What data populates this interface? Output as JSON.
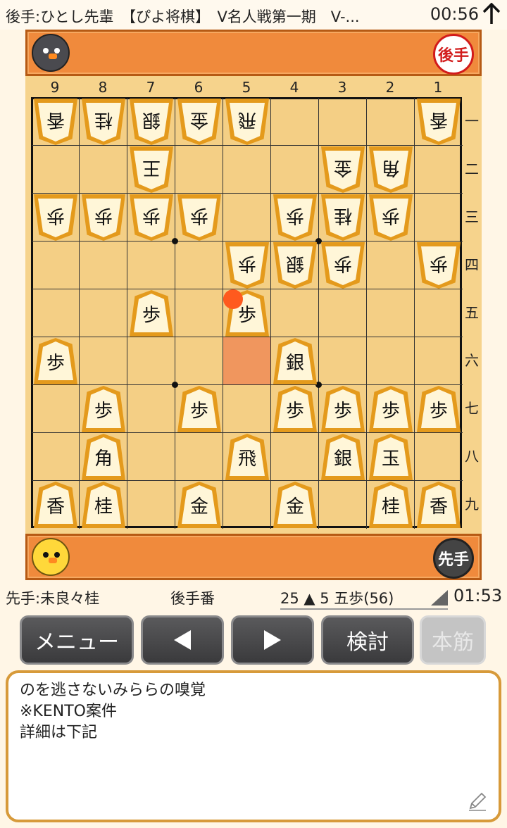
{
  "status": {
    "title": "後手:ひとし先輩　【ぴよ将棋】　V名人戦第一期　V-...",
    "clock": "00:56"
  },
  "top_hand": {
    "badge": "後手"
  },
  "bottom_hand": {
    "badge": "先手"
  },
  "file_labels": [
    "9",
    "8",
    "7",
    "6",
    "5",
    "4",
    "3",
    "2",
    "1"
  ],
  "rank_labels": [
    "一",
    "二",
    "三",
    "四",
    "五",
    "六",
    "七",
    "八",
    "九"
  ],
  "pieces": [
    {
      "file": 9,
      "rank": 1,
      "char": "香",
      "owner": "gote"
    },
    {
      "file": 8,
      "rank": 1,
      "char": "桂",
      "owner": "gote"
    },
    {
      "file": 7,
      "rank": 1,
      "char": "銀",
      "owner": "gote"
    },
    {
      "file": 6,
      "rank": 1,
      "char": "金",
      "owner": "gote"
    },
    {
      "file": 5,
      "rank": 1,
      "char": "飛",
      "owner": "gote"
    },
    {
      "file": 1,
      "rank": 1,
      "char": "香",
      "owner": "gote"
    },
    {
      "file": 7,
      "rank": 2,
      "char": "王",
      "owner": "gote"
    },
    {
      "file": 3,
      "rank": 2,
      "char": "金",
      "owner": "gote"
    },
    {
      "file": 2,
      "rank": 2,
      "char": "角",
      "owner": "gote"
    },
    {
      "file": 9,
      "rank": 3,
      "char": "歩",
      "owner": "gote"
    },
    {
      "file": 8,
      "rank": 3,
      "char": "歩",
      "owner": "gote"
    },
    {
      "file": 7,
      "rank": 3,
      "char": "歩",
      "owner": "gote"
    },
    {
      "file": 6,
      "rank": 3,
      "char": "歩",
      "owner": "gote"
    },
    {
      "file": 4,
      "rank": 3,
      "char": "歩",
      "owner": "gote"
    },
    {
      "file": 3,
      "rank": 3,
      "char": "桂",
      "owner": "gote"
    },
    {
      "file": 2,
      "rank": 3,
      "char": "歩",
      "owner": "gote"
    },
    {
      "file": 5,
      "rank": 4,
      "char": "歩",
      "owner": "gote"
    },
    {
      "file": 4,
      "rank": 4,
      "char": "銀",
      "owner": "gote"
    },
    {
      "file": 3,
      "rank": 4,
      "char": "歩",
      "owner": "gote"
    },
    {
      "file": 1,
      "rank": 4,
      "char": "歩",
      "owner": "gote"
    },
    {
      "file": 7,
      "rank": 5,
      "char": "歩",
      "owner": "sente"
    },
    {
      "file": 5,
      "rank": 5,
      "char": "歩",
      "owner": "sente"
    },
    {
      "file": 9,
      "rank": 6,
      "char": "歩",
      "owner": "sente"
    },
    {
      "file": 4,
      "rank": 6,
      "char": "銀",
      "owner": "sente"
    },
    {
      "file": 8,
      "rank": 7,
      "char": "歩",
      "owner": "sente"
    },
    {
      "file": 6,
      "rank": 7,
      "char": "歩",
      "owner": "sente"
    },
    {
      "file": 4,
      "rank": 7,
      "char": "歩",
      "owner": "sente"
    },
    {
      "file": 3,
      "rank": 7,
      "char": "歩",
      "owner": "sente"
    },
    {
      "file": 2,
      "rank": 7,
      "char": "歩",
      "owner": "sente"
    },
    {
      "file": 1,
      "rank": 7,
      "char": "歩",
      "owner": "sente"
    },
    {
      "file": 8,
      "rank": 8,
      "char": "角",
      "owner": "sente"
    },
    {
      "file": 5,
      "rank": 8,
      "char": "飛",
      "owner": "sente"
    },
    {
      "file": 3,
      "rank": 8,
      "char": "銀",
      "owner": "sente"
    },
    {
      "file": 2,
      "rank": 8,
      "char": "玉",
      "owner": "sente"
    },
    {
      "file": 9,
      "rank": 9,
      "char": "香",
      "owner": "sente"
    },
    {
      "file": 8,
      "rank": 9,
      "char": "桂",
      "owner": "sente"
    },
    {
      "file": 6,
      "rank": 9,
      "char": "金",
      "owner": "sente"
    },
    {
      "file": 4,
      "rank": 9,
      "char": "金",
      "owner": "sente"
    },
    {
      "file": 2,
      "rank": 9,
      "char": "桂",
      "owner": "sente"
    },
    {
      "file": 1,
      "rank": 9,
      "char": "香",
      "owner": "sente"
    }
  ],
  "last_move_square": {
    "file": 5,
    "rank": 6
  },
  "last_move_dot": {
    "file": 5,
    "rank": 5
  },
  "info": {
    "sente_name": "先手:未良々桂",
    "turn": "後手番",
    "move": "25 ▲ 5 五歩(56)",
    "elapsed": "01:53"
  },
  "toolbar": {
    "menu": "メニュー",
    "study": "検討",
    "mainline": "本筋"
  },
  "comment": [
    "のを逃さないみららの嗅覚",
    "※KENTO案件",
    "詳細は下記"
  ]
}
